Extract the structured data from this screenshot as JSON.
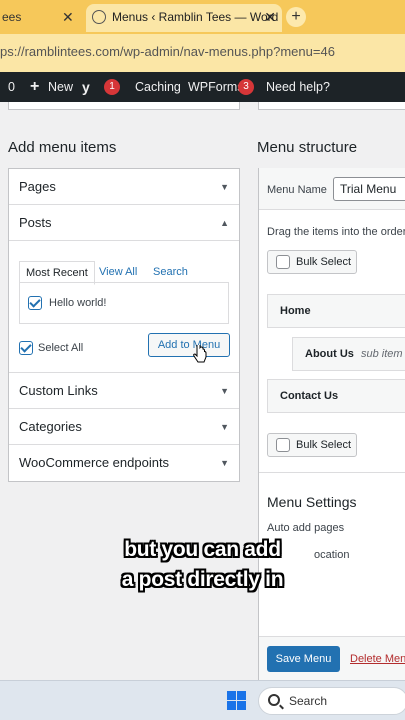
{
  "browser": {
    "tab_partial": "ees",
    "tab_active": "Menus ‹ Ramblin Tees — Word",
    "url": "ps://ramblintees.com/wp-admin/nav-menus.php?menu=46"
  },
  "adminbar": {
    "count_left": "0",
    "new_label": "New",
    "yoast_count": "1",
    "caching_label": "Caching",
    "wpforms_label": "WPForms",
    "wpforms_count": "3",
    "help_label": "Need help?"
  },
  "add_menu_items": {
    "heading": "Add menu items",
    "sections": {
      "pages": "Pages",
      "posts": "Posts",
      "custom_links": "Custom Links",
      "categories": "Categories",
      "woocommerce": "WooCommerce endpoints"
    },
    "posts_tabs": [
      "Most Recent",
      "View All",
      "Search"
    ],
    "post_item": "Hello world!",
    "select_all": "Select All",
    "add_button": "Add to Menu"
  },
  "menu_structure": {
    "heading": "Menu structure",
    "menu_name_label": "Menu Name",
    "menu_name_value": "Trial Menu",
    "instructions": "Drag the items into the order",
    "bulk_select": "Bulk Select",
    "items": [
      {
        "title": "Home",
        "sub": ""
      },
      {
        "title": "About Us",
        "sub": "sub item"
      },
      {
        "title": "Contact Us",
        "sub": ""
      }
    ],
    "settings_heading": "Menu Settings",
    "auto_add": "Auto add pages",
    "display_location": "ocation",
    "save_button": "Save Menu",
    "delete_link": "Delete Menu"
  },
  "caption": {
    "line1": "but you can add",
    "line2": "a post directly in"
  },
  "taskbar": {
    "search_label": "Search"
  }
}
